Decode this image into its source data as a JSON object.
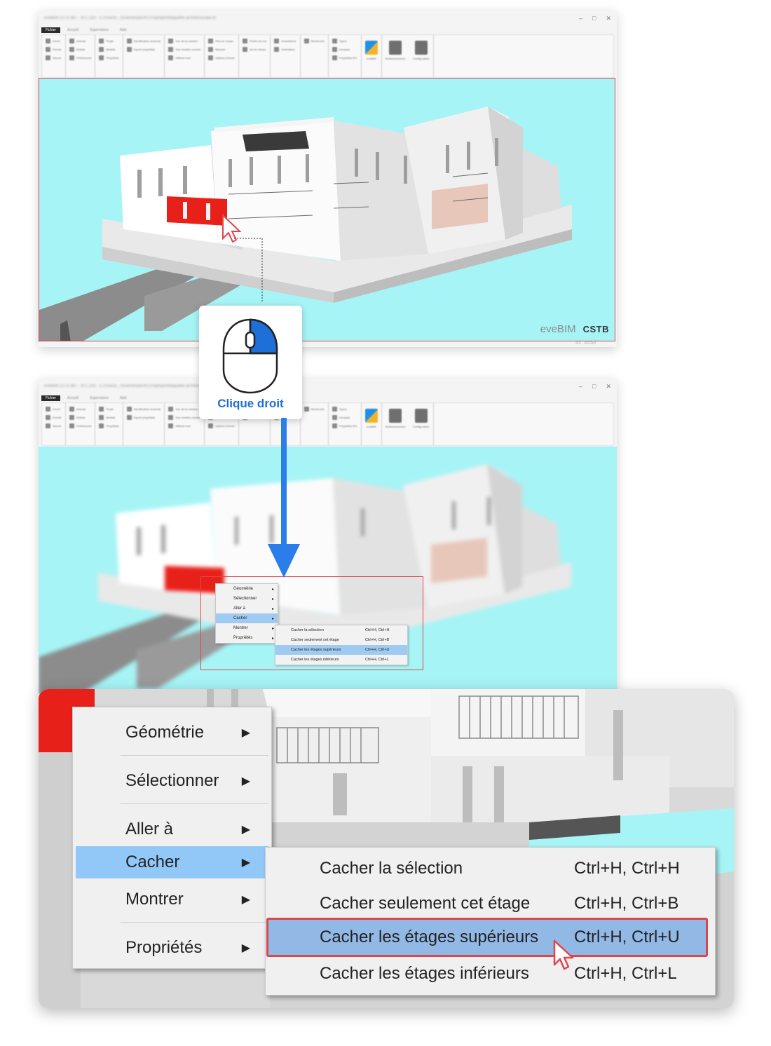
{
  "colors": {
    "accent_red": "#e0464b",
    "accent_blue": "#1d6fd6",
    "menu_highlight": "#92c8f8",
    "viewport_bg": "#a7f4f6"
  },
  "app": {
    "title": "eveBIM 3.0.4.367 - IFC 2x3 - C:/Users/.../Downloads/IFC/Olympe/Maquette architecturale.ifc",
    "menu_tabs": [
      "Fichier",
      "Accueil",
      "Superviseur",
      "Aide"
    ],
    "ribbon_groups": [
      {
        "items": [
          "Ouvrir",
          "Fermer",
          "Sauver"
        ]
      },
      {
        "items": [
          "Annuler",
          "Refaire",
          "Préférences"
        ]
      },
      {
        "items": [
          "Projet",
          "Modèle",
          "Propriétés"
        ]
      },
      {
        "items": [
          "Identification avancée",
          "Export propriétés",
          ""
        ]
      },
      {
        "items": [
          "Vue de la caméra",
          "Vue modèle courant",
          "Afficher tout"
        ]
      },
      {
        "items": [
          "Plan de coupe",
          "Mesurer",
          "Options d'écran"
        ]
      },
      {
        "items": [
          "Pointe de vue",
          "Sur le niveau",
          ""
        ]
      },
      {
        "items": [
          "Annotations",
          "Orientation",
          ""
        ]
      },
      {
        "items": [
          "Recherche",
          "",
          ""
        ]
      },
      {
        "items": [
          "Types",
          "Groupes",
          "Propriétés IFC"
        ]
      }
    ],
    "ribbon_big": [
      "eveBIM",
      "Redimensionner",
      "Configuration"
    ],
    "watermark_brand": "eveBIM",
    "watermark_partner": "CSTB",
    "status_text": "IFC · IFC2x3"
  },
  "mouse_callout": {
    "label": "Clique droit"
  },
  "context_menu": {
    "items": [
      {
        "label": "Géométrie",
        "arrow": "▶"
      },
      {
        "label": "Sélectionner",
        "arrow": "▶"
      },
      {
        "label": "Aller à",
        "arrow": "▶"
      },
      {
        "label": "Cacher",
        "arrow": "▶"
      },
      {
        "label": "Montrer",
        "arrow": "▶"
      },
      {
        "label": "Propriétés",
        "arrow": "▶"
      }
    ],
    "highlighted_index": 3
  },
  "submenu": {
    "items": [
      {
        "label": "Cacher la sélection",
        "shortcut": "Ctrl+H, Ctrl+H"
      },
      {
        "label": "Cacher seulement cet étage",
        "shortcut": "Ctrl+H, Ctrl+B"
      },
      {
        "label": "Cacher les étages supérieurs",
        "shortcut": "Ctrl+H, Ctrl+U"
      },
      {
        "label": "Cacher les étages inférieurs",
        "shortcut": "Ctrl+H, Ctrl+L"
      }
    ],
    "highlighted_index": 2
  }
}
